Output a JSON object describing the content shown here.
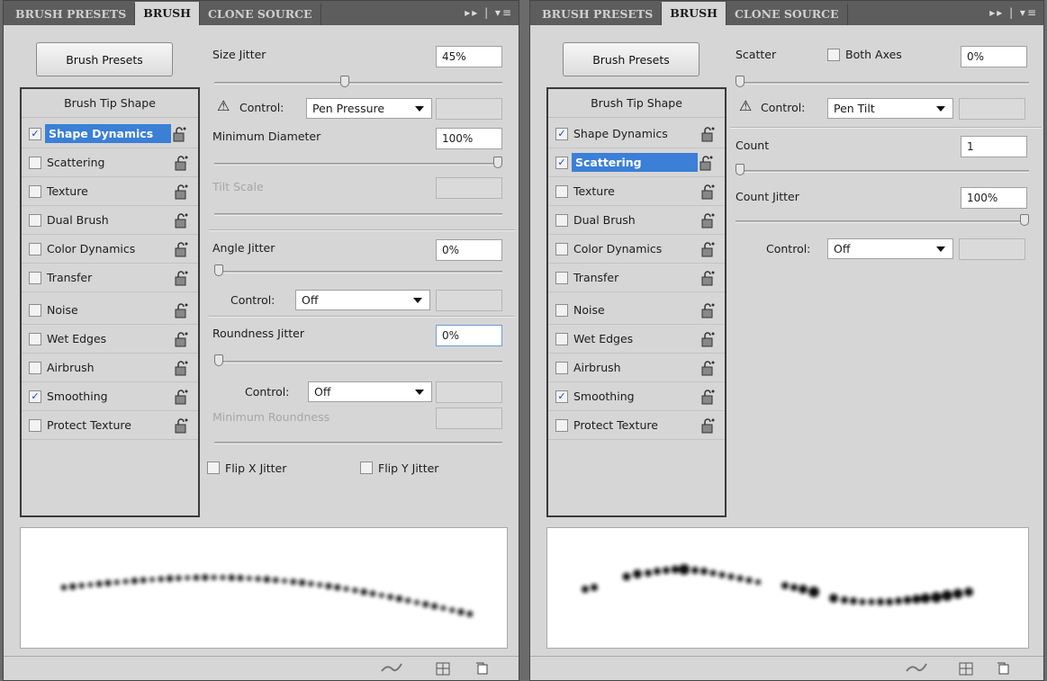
{
  "left": {
    "tabs": [
      "BRUSH PRESETS",
      "BRUSH",
      "CLONE SOURCE"
    ],
    "active_tab": "BRUSH",
    "tab_controls": "▸▸ | ▾≡",
    "brush_presets_button": "Brush Presets",
    "brush_tip_shape": "Brush Tip Shape",
    "options": [
      {
        "label": "Shape Dynamics",
        "checked": true,
        "selected": true
      },
      {
        "label": "Scattering",
        "checked": false
      },
      {
        "label": "Texture",
        "checked": false
      },
      {
        "label": "Dual Brush",
        "checked": false
      },
      {
        "label": "Color Dynamics",
        "checked": false
      },
      {
        "label": "Transfer",
        "checked": false
      },
      {
        "label": "Noise",
        "checked": false
      },
      {
        "label": "Wet Edges",
        "checked": false
      },
      {
        "label": "Airbrush",
        "checked": false
      },
      {
        "label": "Smoothing",
        "checked": true
      },
      {
        "label": "Protect Texture",
        "checked": false
      }
    ],
    "size_jitter": {
      "label": "Size Jitter",
      "value": "45%",
      "slider": 0.45
    },
    "control1": {
      "label": "Control:",
      "value": "Pen Pressure"
    },
    "minimum_diameter": {
      "label": "Minimum Diameter",
      "value": "100%",
      "slider": 1.0
    },
    "tilt_scale": {
      "label": "Tilt Scale"
    },
    "angle_jitter": {
      "label": "Angle Jitter",
      "value": "0%",
      "slider": 0
    },
    "control2": {
      "label": "Control:",
      "value": "Off"
    },
    "roundness_jitter": {
      "label": "Roundness Jitter",
      "value": "0%",
      "slider": 0
    },
    "control3": {
      "label": "Control:",
      "value": "Off"
    },
    "minimum_roundness": {
      "label": "Minimum Roundness"
    },
    "flip_x": "Flip X Jitter",
    "flip_y": "Flip Y Jitter"
  },
  "right": {
    "tabs": [
      "BRUSH PRESETS",
      "BRUSH",
      "CLONE SOURCE"
    ],
    "active_tab": "BRUSH",
    "tab_controls": "▸▸ | ▾≡",
    "brush_presets_button": "Brush Presets",
    "brush_tip_shape": "Brush Tip Shape",
    "options": [
      {
        "label": "Shape Dynamics",
        "checked": true
      },
      {
        "label": "Scattering",
        "checked": true,
        "selected": true
      },
      {
        "label": "Texture",
        "checked": false
      },
      {
        "label": "Dual Brush",
        "checked": false
      },
      {
        "label": "Color Dynamics",
        "checked": false
      },
      {
        "label": "Transfer",
        "checked": false
      },
      {
        "label": "Noise",
        "checked": false
      },
      {
        "label": "Wet Edges",
        "checked": false
      },
      {
        "label": "Airbrush",
        "checked": false
      },
      {
        "label": "Smoothing",
        "checked": true
      },
      {
        "label": "Protect Texture",
        "checked": false
      }
    ],
    "scatter": {
      "label": "Scatter",
      "value": "0%",
      "slider": 0
    },
    "both_axes": "Both Axes",
    "control1": {
      "label": "Control:",
      "value": "Pen Tilt"
    },
    "count": {
      "label": "Count",
      "value": "1",
      "slider": 0
    },
    "count_jitter": {
      "label": "Count Jitter",
      "value": "100%",
      "slider": 1.0
    },
    "control2": {
      "label": "Control:",
      "value": "Off"
    }
  },
  "colors": {
    "selection": "#3b7fd6",
    "panel": "#d6d6d6",
    "tabbar": "#5d5d5d"
  }
}
